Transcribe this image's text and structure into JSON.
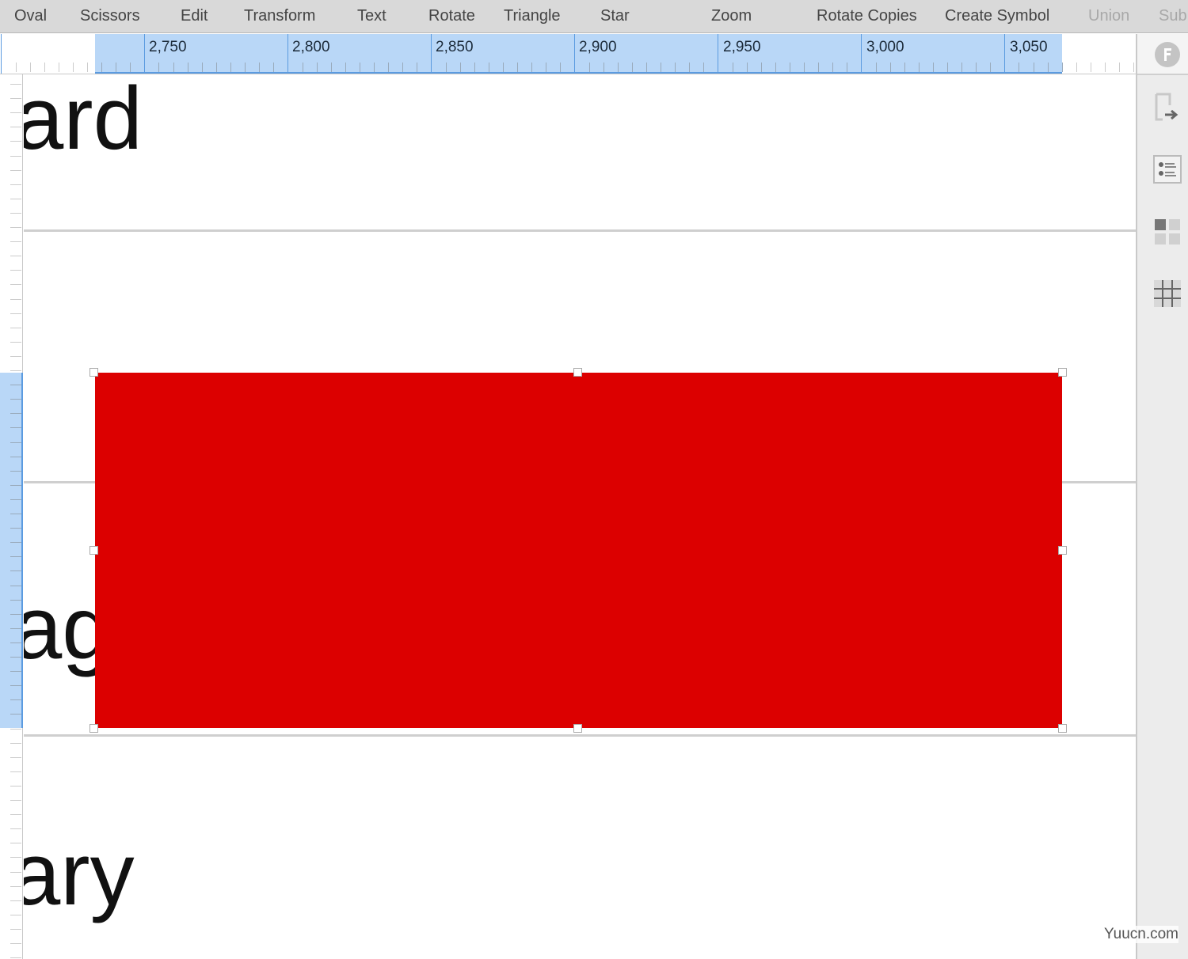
{
  "toolbar": {
    "items": [
      {
        "label": "Oval",
        "enabled": true
      },
      {
        "label": "Scissors",
        "enabled": true
      },
      {
        "label": "Edit",
        "enabled": true
      },
      {
        "label": "Transform",
        "enabled": true
      },
      {
        "label": "Text",
        "enabled": true
      },
      {
        "label": "Rotate",
        "enabled": true
      },
      {
        "label": "Triangle",
        "enabled": true
      },
      {
        "label": "Star",
        "enabled": true
      },
      {
        "label": "Zoom",
        "enabled": true
      },
      {
        "label": "Rotate Copies",
        "enabled": true
      },
      {
        "label": "Create Symbol",
        "enabled": true
      },
      {
        "label": "Union",
        "enabled": false
      },
      {
        "label": "Sub",
        "enabled": false
      }
    ]
  },
  "ruler": {
    "labels": [
      "2,750",
      "2,800",
      "2,850",
      "2,900",
      "2,950",
      "3,000",
      "3,050"
    ],
    "highlight_color": "#b9d7f7"
  },
  "canvas": {
    "texts": [
      "ard",
      "ag",
      "ary"
    ],
    "shape": {
      "type": "rectangle",
      "fill": "#dc0000",
      "selected": true
    }
  },
  "right_panel": {
    "icons": [
      "f-logo-icon",
      "export-icon",
      "list-icon",
      "grid-tiles-icon",
      "table-icon"
    ]
  },
  "watermark": "Yuucn.com"
}
